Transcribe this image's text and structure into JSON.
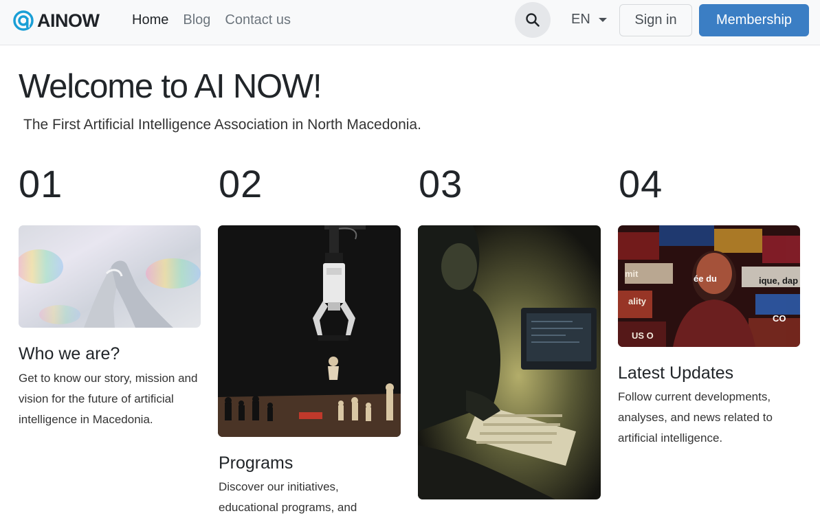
{
  "header": {
    "logo_text": "AINOW",
    "nav": [
      {
        "label": "Home",
        "active": true
      },
      {
        "label": "Blog",
        "active": false
      },
      {
        "label": "Contact us",
        "active": false
      }
    ],
    "search_icon": "search-icon",
    "language": "EN",
    "signin_label": "Sign in",
    "membership_label": "Membership"
  },
  "hero": {
    "title": "Welcome to AI NOW!",
    "subtitle": "The First Artificial Intelligence Association in North Macedonia."
  },
  "cards": [
    {
      "number": "01",
      "title": "Who we are?",
      "description": "Get to know our story, mission and vision for the future of artificial intelligence in Macedonia."
    },
    {
      "number": "02",
      "title": "Programs",
      "description": "Discover our initiatives, educational programs, and"
    },
    {
      "number": "03",
      "title": "",
      "description": ""
    },
    {
      "number": "04",
      "title": "Latest Updates",
      "description": "Follow current developments, analyses, and news related to artificial intelligence."
    }
  ],
  "colors": {
    "accent": "#3b7ec4",
    "logo": "#1a9fd6"
  }
}
